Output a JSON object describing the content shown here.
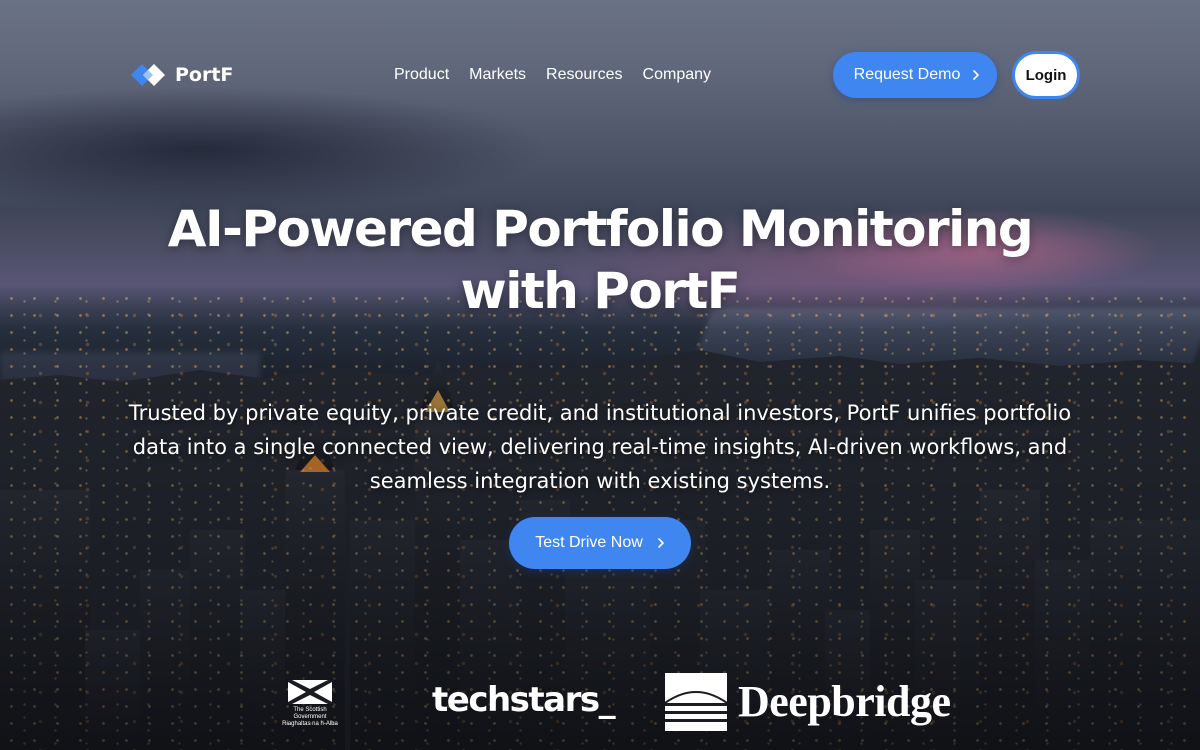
{
  "brand": {
    "name": "PortF",
    "primary_color": "#3f86f0"
  },
  "nav": {
    "items": [
      {
        "label": "Product"
      },
      {
        "label": "Markets"
      },
      {
        "label": "Resources"
      },
      {
        "label": "Company"
      }
    ]
  },
  "header": {
    "demo_label": "Request Demo",
    "login_label": "Login"
  },
  "hero": {
    "title_line1": "AI-Powered Portfolio Monitoring",
    "title_line2": "with PortF",
    "subtitle": "Trusted by private equity, private credit, and institutional investors, PortF unifies portfolio data into a single connected view, delivering real-time insights, AI-driven workflows, and seamless integration with existing systems.",
    "cta_label": "Test Drive Now"
  },
  "partners": {
    "scottish_gov": {
      "line1": "The Scottish",
      "line2": "Government",
      "line3": "Riaghaltas na h-Alba"
    },
    "techstars": "techstars_",
    "deepbridge": "Deepbridge"
  },
  "icons": {
    "chevron": "chevron-right-icon",
    "logo": "portf-logo-icon",
    "saltire": "saltire-icon",
    "deepbridge_mark": "deepbridge-mark-icon"
  }
}
